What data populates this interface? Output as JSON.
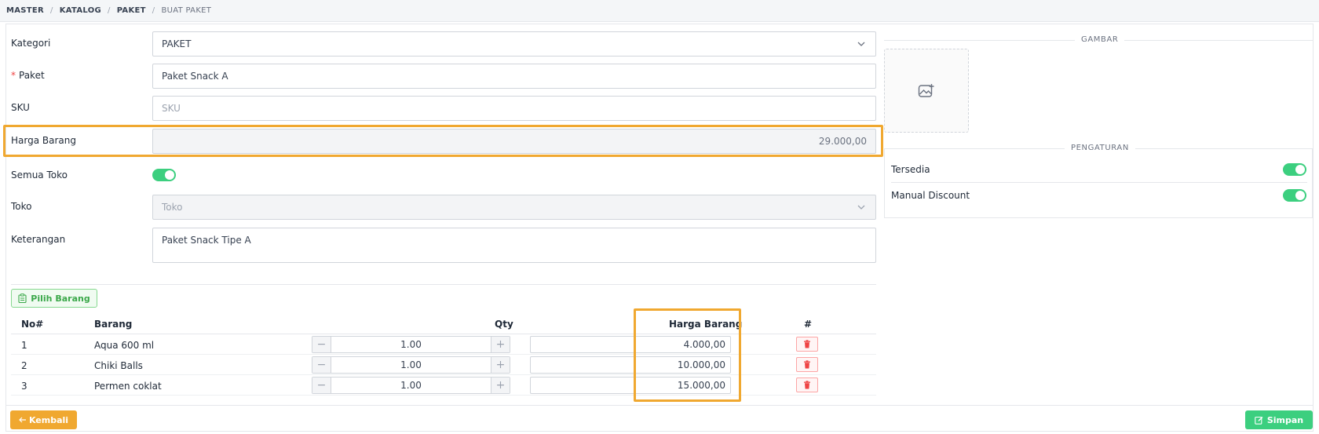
{
  "breadcrumb": [
    "MASTER",
    "KATALOG",
    "PAKET",
    "BUAT PAKET"
  ],
  "form": {
    "kategori": {
      "label": "Kategori",
      "value": "PAKET"
    },
    "paket": {
      "required_mark": "*",
      "label": "Paket",
      "value": "Paket Snack A"
    },
    "sku": {
      "label": "SKU",
      "placeholder": "SKU"
    },
    "harga_barang": {
      "label": "Harga Barang",
      "value": "29.000,00"
    },
    "semua_toko": {
      "label": "Semua Toko",
      "enabled": true
    },
    "toko": {
      "label": "Toko",
      "placeholder": "Toko"
    },
    "keterangan": {
      "label": "Keterangan",
      "value": "Paket Snack Tipe A"
    }
  },
  "pilih_barang_label": "Pilih Barang",
  "table": {
    "headers": {
      "no": "No#",
      "barang": "Barang",
      "qty": "Qty",
      "harga": "Harga Barang",
      "action": "#"
    },
    "rows": [
      {
        "no": "1",
        "barang": "Aqua 600 ml",
        "qty": "1.00",
        "harga": "4.000,00"
      },
      {
        "no": "2",
        "barang": "Chiki Balls",
        "qty": "1.00",
        "harga": "10.000,00"
      },
      {
        "no": "3",
        "barang": "Permen coklat",
        "qty": "1.00",
        "harga": "15.000,00"
      }
    ]
  },
  "gambar": {
    "title": "GAMBAR"
  },
  "pengaturan": {
    "title": "PENGATURAN",
    "items": [
      {
        "label": "Tersedia",
        "enabled": true
      },
      {
        "label": "Manual Discount",
        "enabled": true
      }
    ]
  },
  "buttons": {
    "kembali": "Kembali",
    "simpan": "Simpan"
  },
  "colors": {
    "accent_orange": "#f0a830",
    "accent_green": "#3ccf7f",
    "danger": "#ef4444"
  },
  "icons": {
    "image_placeholder": "image-plus-icon",
    "pilih": "clipboard-icon",
    "delete": "trash-icon",
    "back": "arrow-left-icon",
    "save": "edit-icon"
  }
}
